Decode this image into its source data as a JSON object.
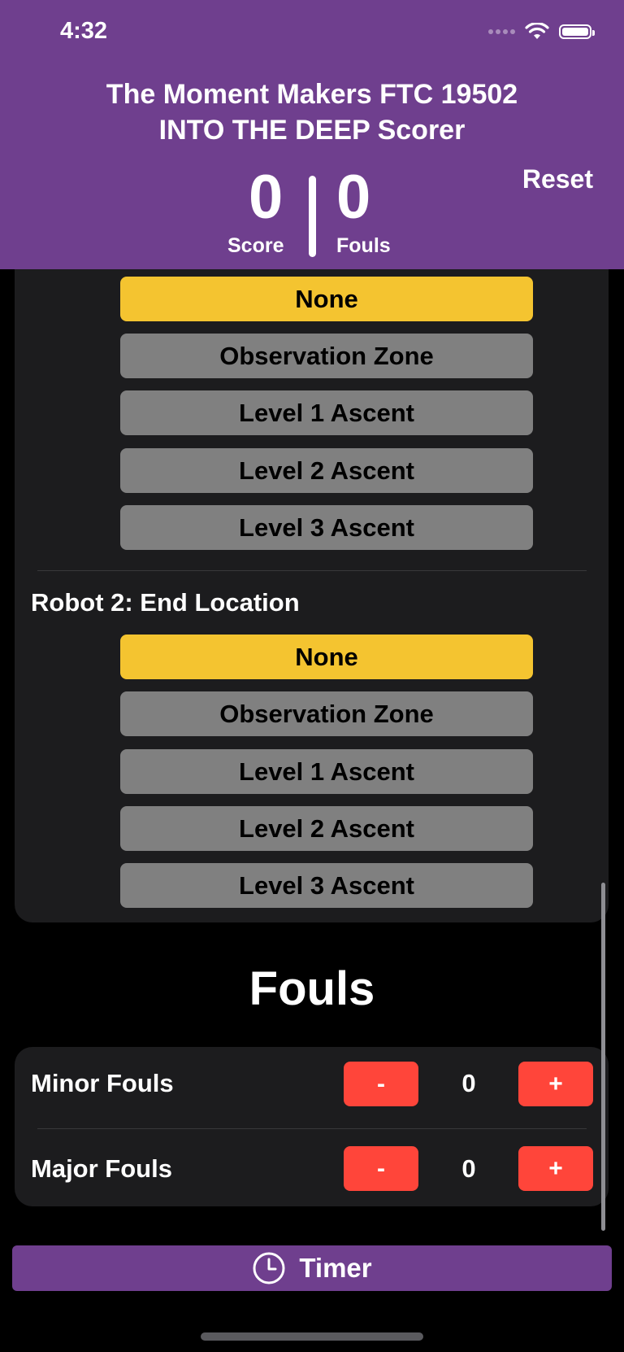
{
  "status_bar": {
    "time": "4:32"
  },
  "header": {
    "title_line1": "The Moment Makers FTC 19502",
    "title_line2": "INTO THE DEEP Scorer",
    "score_value": "0",
    "score_label": "Score",
    "fouls_value": "0",
    "fouls_label": "Fouls",
    "reset_label": "Reset"
  },
  "robot1_end": {
    "options": [
      "None",
      "Observation Zone",
      "Level 1 Ascent",
      "Level 2 Ascent",
      "Level 3 Ascent"
    ],
    "selected": "None"
  },
  "robot2_end": {
    "label": "Robot 2: End Location",
    "options": [
      "None",
      "Observation Zone",
      "Level 1 Ascent",
      "Level 2 Ascent",
      "Level 3 Ascent"
    ],
    "selected": "None"
  },
  "fouls": {
    "title": "Fouls",
    "minor_label": "Minor Fouls",
    "minor_count": "0",
    "major_label": "Major Fouls",
    "major_count": "0",
    "minus_label": "-",
    "plus_label": "+"
  },
  "timer": {
    "label": "Timer",
    "icon": "clock-icon"
  },
  "colors": {
    "header_bg": "#6f3f8e",
    "selected_option": "#f4c430",
    "option_bg": "#808080",
    "foul_button": "#ff453a",
    "card_bg": "#1c1c1e"
  }
}
